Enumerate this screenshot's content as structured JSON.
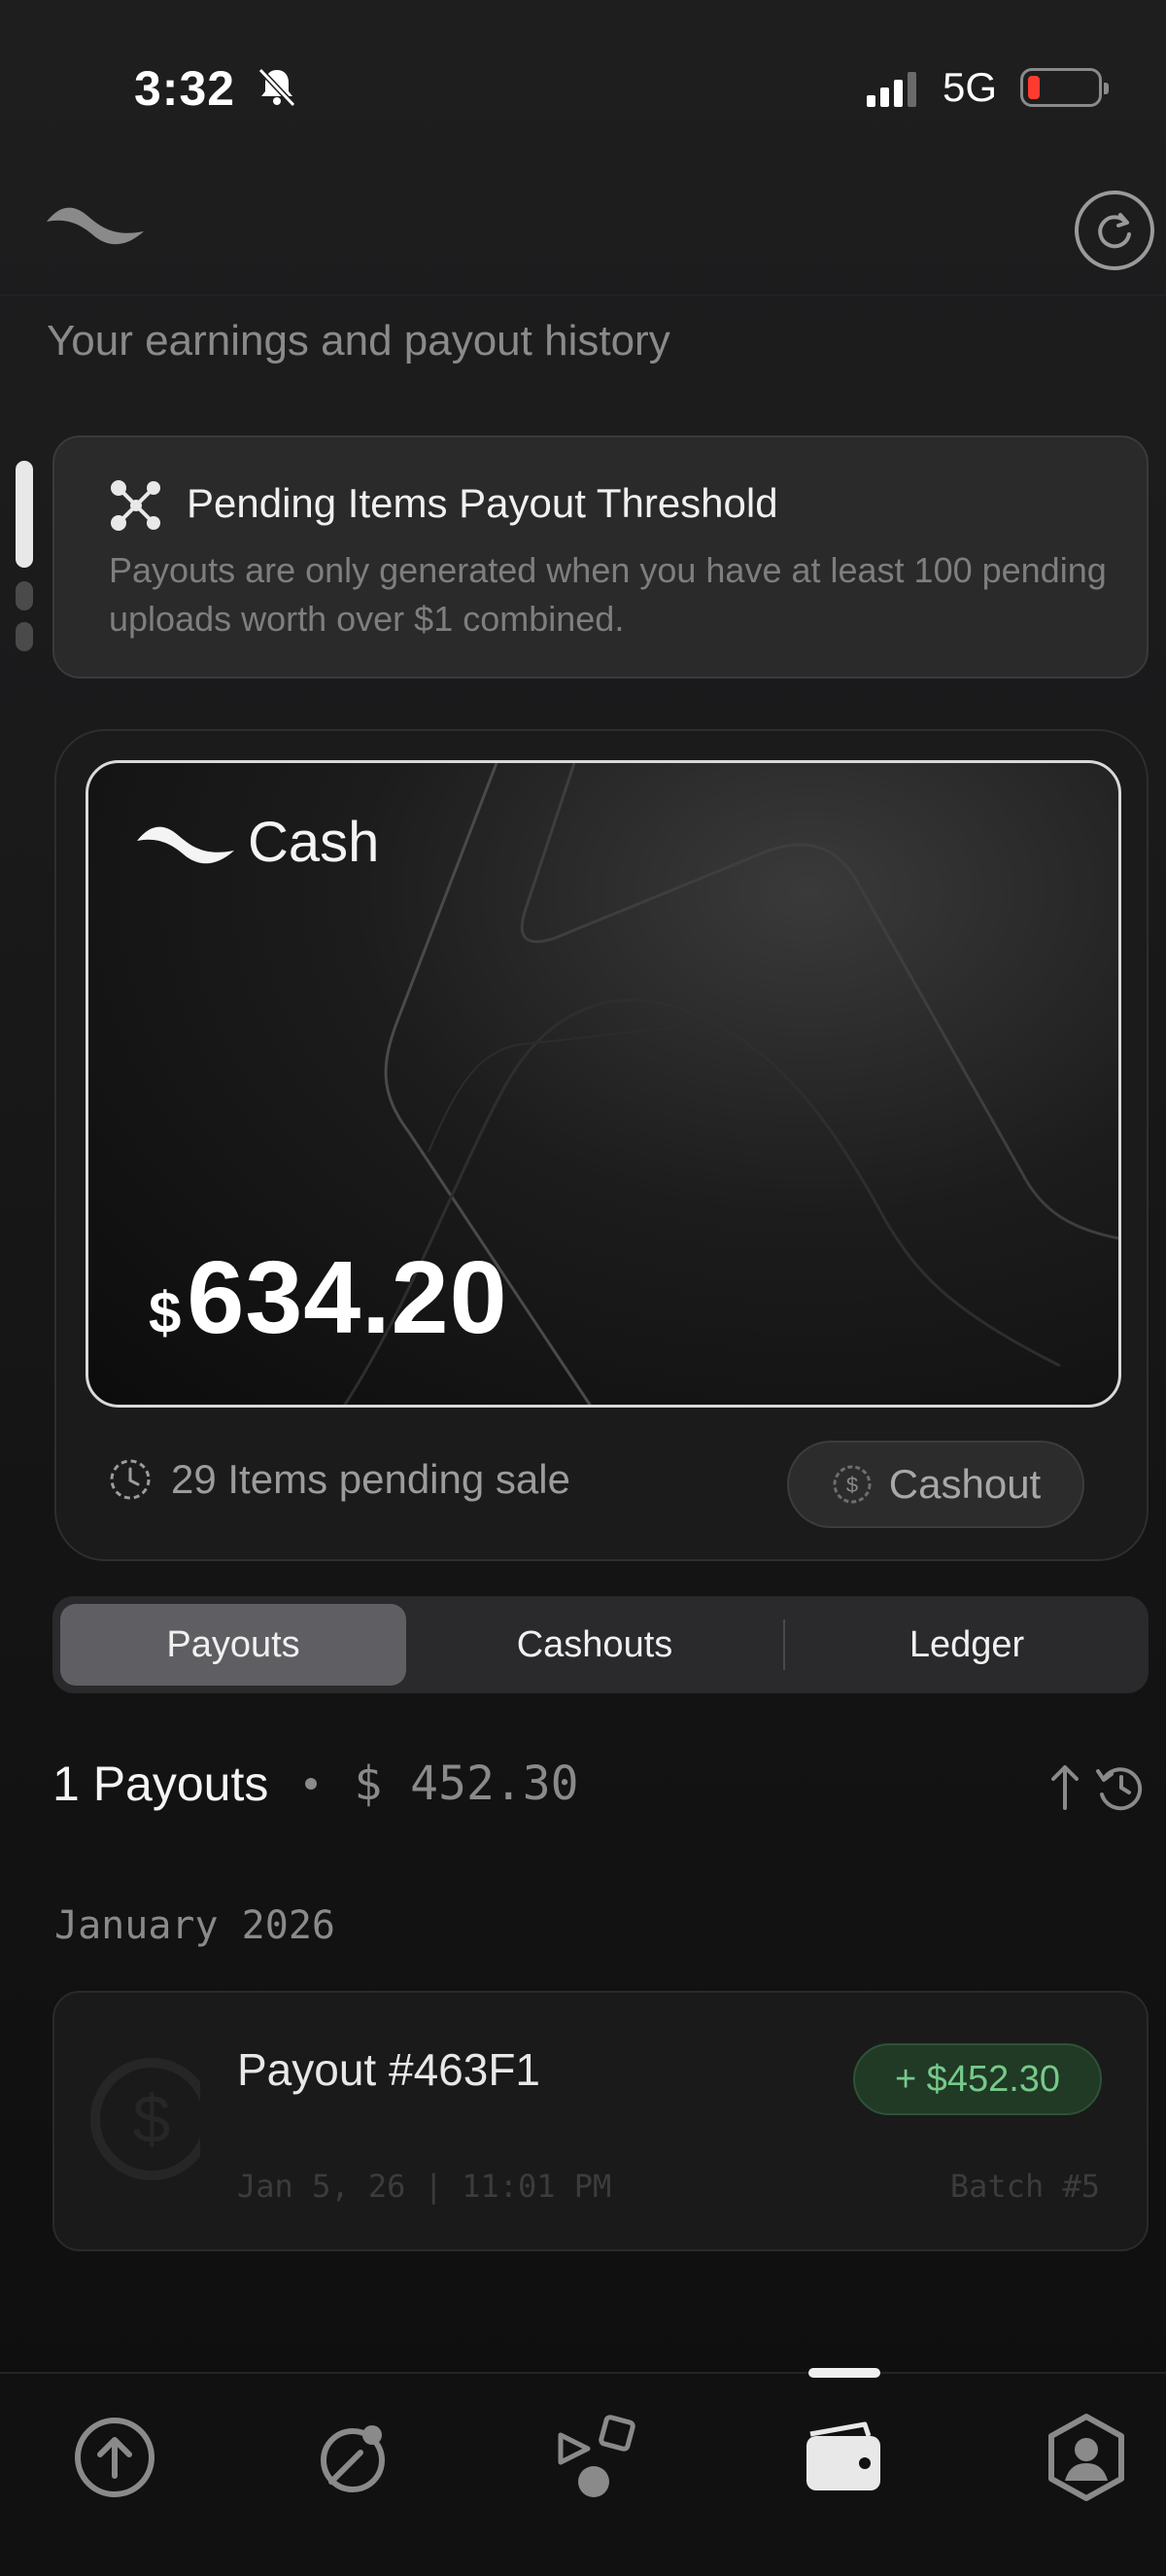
{
  "status_bar": {
    "time": "3:32",
    "network": "5G"
  },
  "header": {
    "subtitle": "Your earnings and payout history"
  },
  "threshold": {
    "title": "Pending Items Payout Threshold",
    "text": "Payouts are only generated when you have at least 100 pending uploads worth over $1 combined."
  },
  "wallet": {
    "card_label": "Cash",
    "currency_symbol": "$",
    "balance": "634.20",
    "pending_text": "29 Items pending sale",
    "cashout_label": "Cashout"
  },
  "tabs": [
    {
      "label": "Payouts",
      "active": true
    },
    {
      "label": "Cashouts",
      "active": false
    },
    {
      "label": "Ledger",
      "active": false
    }
  ],
  "summary": {
    "count_label": "1 Payouts",
    "total": "$ 452.30"
  },
  "groups": [
    {
      "month": "January 2026",
      "items": [
        {
          "title": "Payout #463F1",
          "amount": "+ $452.30",
          "date": "Jan 5, 26 | 11:01 PM",
          "batch": "Batch #5"
        }
      ]
    }
  ],
  "nav": {
    "items": [
      {
        "icon": "upload-icon"
      },
      {
        "icon": "explore-icon"
      },
      {
        "icon": "shapes-icon"
      },
      {
        "icon": "wallet-icon",
        "active": true
      },
      {
        "icon": "profile-icon"
      }
    ]
  },
  "colors": {
    "accent_green": "#77c98a",
    "battery_low": "#ff3b30"
  }
}
